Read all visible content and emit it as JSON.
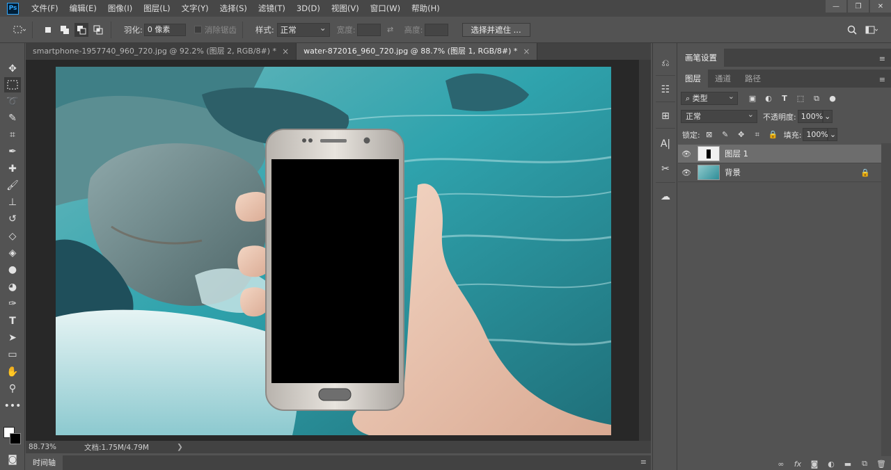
{
  "menu": [
    "文件(F)",
    "编辑(E)",
    "图像(I)",
    "图层(L)",
    "文字(Y)",
    "选择(S)",
    "滤镜(T)",
    "3D(D)",
    "视图(V)",
    "窗口(W)",
    "帮助(H)"
  ],
  "app_logo": "Ps",
  "window_controls": [
    "—",
    "❐",
    "✕"
  ],
  "options": {
    "feather_label": "羽化:",
    "feather_value": "0 像素",
    "antialias_label": "消除锯齿",
    "style_label": "样式:",
    "style_value": "正常",
    "width_label": "宽度:",
    "height_label": "高度:",
    "select_mask_button": "选择并遮住 ..."
  },
  "tabs": [
    {
      "label": "smartphone-1957740_960_720.jpg @ 92.2% (图层 2, RGB/8#) *",
      "close": "×"
    },
    {
      "label": "water-872016_960_720.jpg @ 88.7% (图层 1, RGB/8#) *",
      "close": "×"
    }
  ],
  "status": {
    "zoom": "88.73%",
    "doc_label": "文档:1.75M/4.79M",
    "arrow": "❯"
  },
  "timeline_label": "时间轴",
  "brush_panel": {
    "tab": "画笔设置"
  },
  "layers_panel": {
    "tabs": [
      "图层",
      "通道",
      "路径"
    ],
    "filter_kind": "类型",
    "blend_mode": "正常",
    "opacity_label": "不透明度:",
    "opacity_value": "100%",
    "lock_label": "锁定:",
    "fill_label": "填充:",
    "fill_value": "100%",
    "layers": [
      {
        "name": "图层 1",
        "locked": false
      },
      {
        "name": "背景",
        "locked": true
      }
    ]
  },
  "colors": {
    "fg": "#ffffff",
    "bg": "#000000",
    "accent": "#31a8ff"
  }
}
